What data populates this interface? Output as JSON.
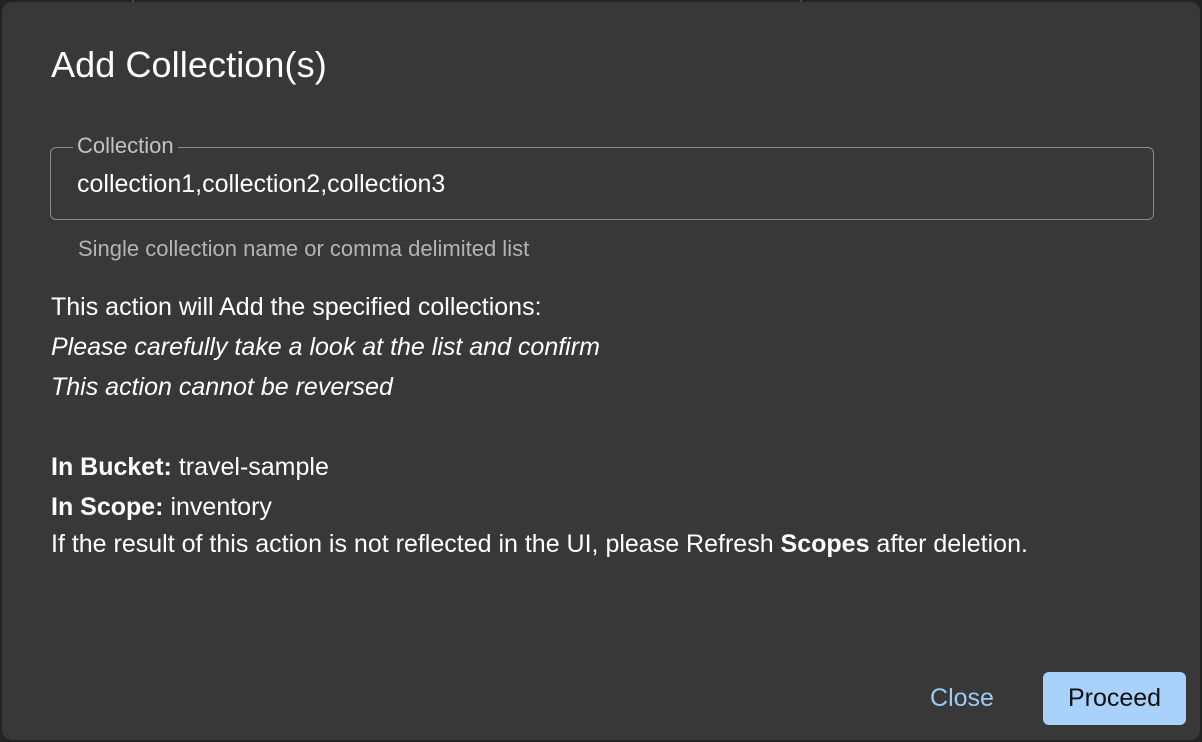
{
  "dialog": {
    "title": "Add Collection(s)",
    "field": {
      "label": "Collection",
      "value": "collection1,collection2,collection3",
      "helper": "Single collection name or comma delimited list"
    },
    "message": {
      "line1": "This action will Add the specified collections:",
      "line2": "Please carefully take a look at the list and confirm",
      "line3": "This action cannot be reversed"
    },
    "bucket": {
      "label": "In Bucket:",
      "value": "travel-sample"
    },
    "scope": {
      "label": "In Scope:",
      "value": "inventory"
    },
    "note": {
      "before": "If the result of this action is not reflected in the UI, please Refresh ",
      "emphasis": "Scopes",
      "after": " after deletion."
    },
    "buttons": {
      "close": "Close",
      "proceed": "Proceed"
    }
  },
  "colors": {
    "dialog_background": "#383838",
    "accent": "#a8d2fb",
    "link": "#9fc9f5"
  }
}
